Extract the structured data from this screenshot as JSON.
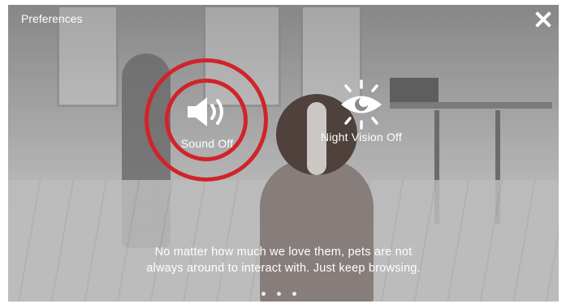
{
  "header": {
    "title": "Preferences",
    "close_icon": "close-icon"
  },
  "options": {
    "sound": {
      "label": "Sound Off",
      "icon": "speaker-icon",
      "highlight_color": "#d1232a"
    },
    "night_vision": {
      "label": "Night Vision Off",
      "icon": "night-vision-eye-icon"
    }
  },
  "caption": {
    "line1": "No matter how much we love them, pets are not",
    "line2": "always around to interact with. Just keep browsing."
  },
  "pagination": {
    "total": 3,
    "active": 1
  }
}
